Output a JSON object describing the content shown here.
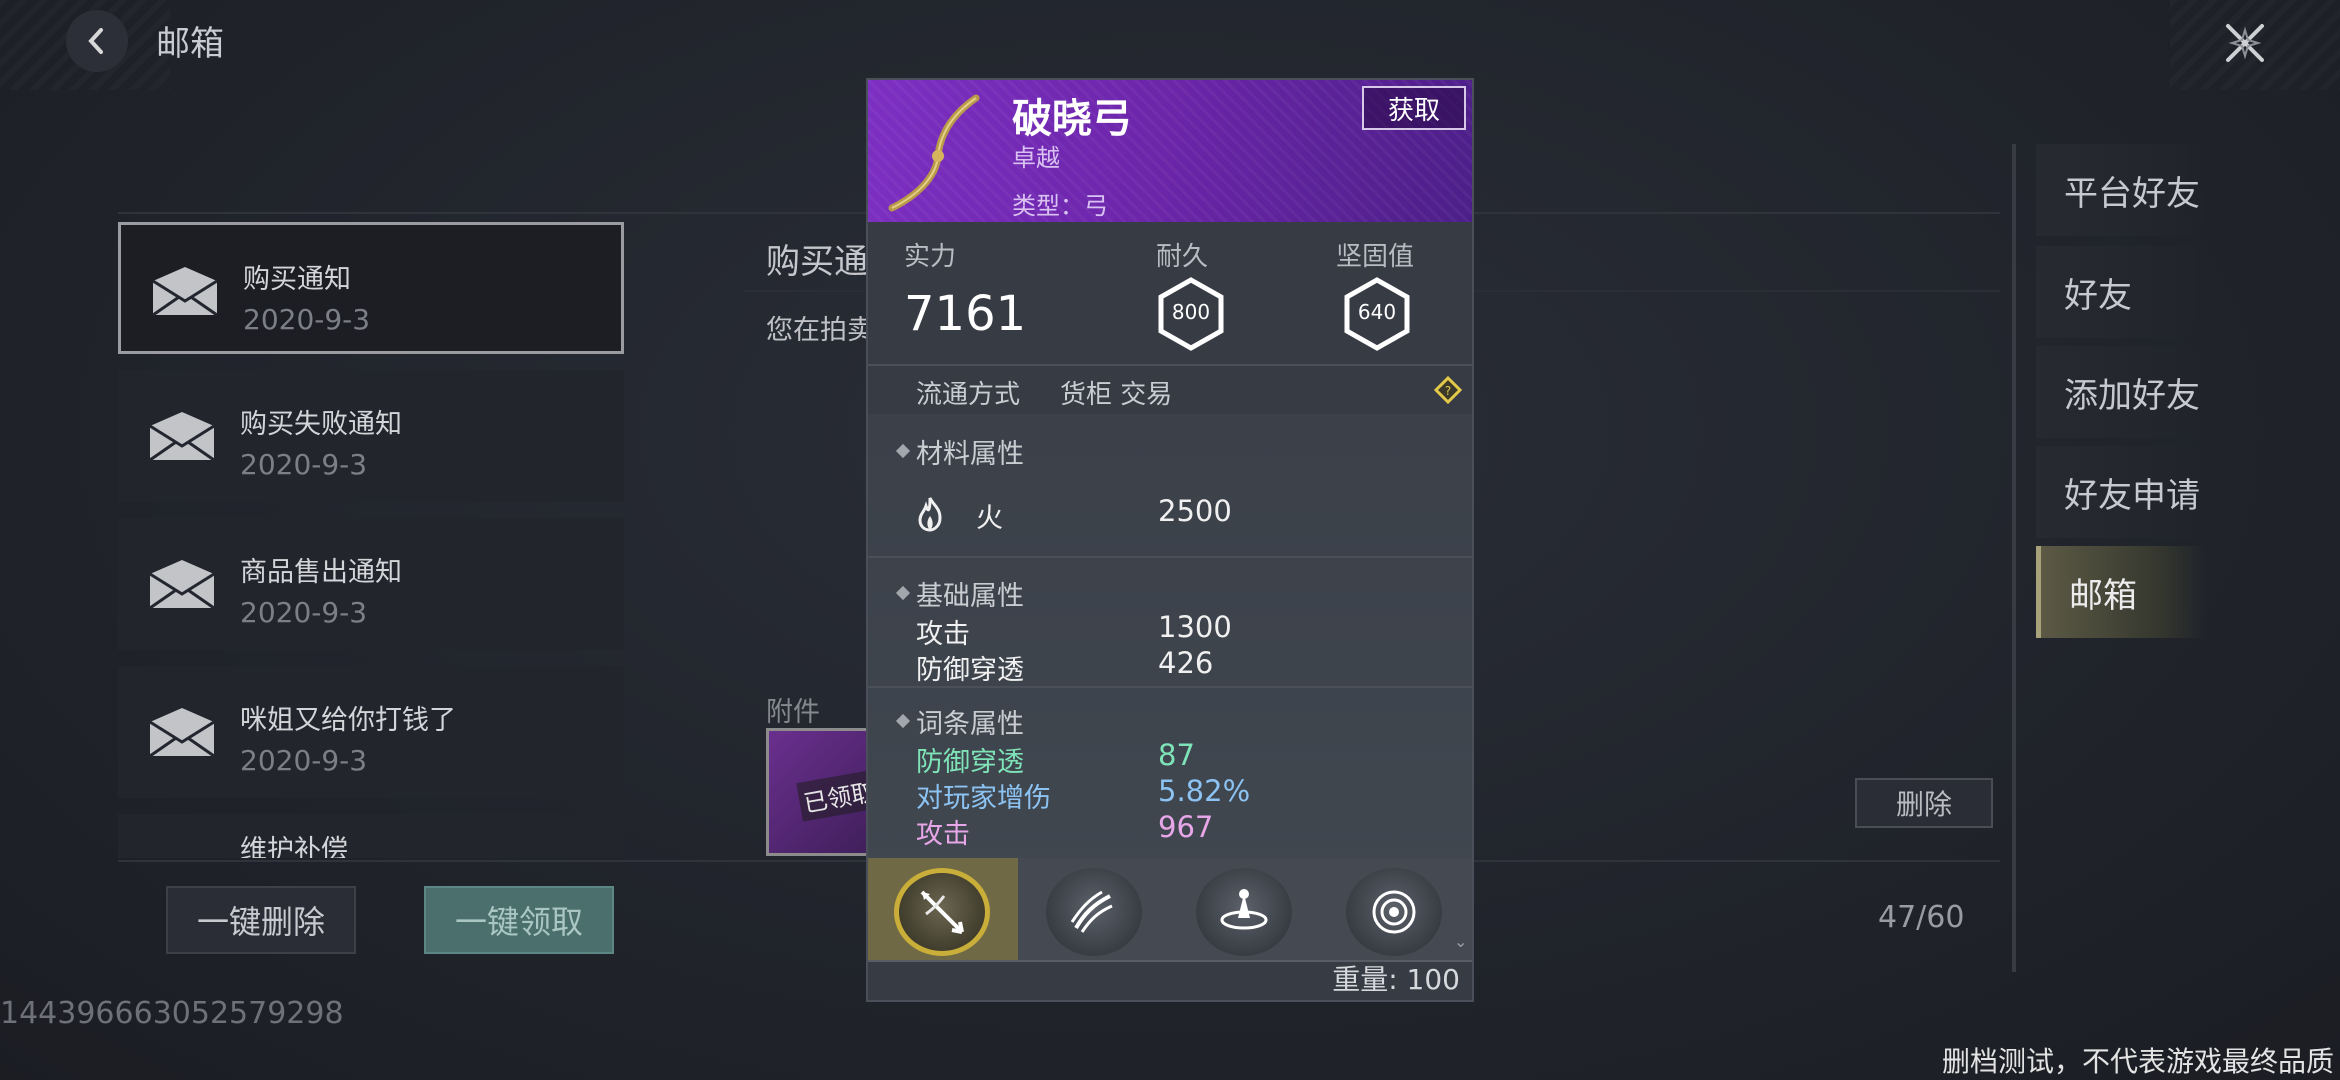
{
  "header": {
    "title": "邮箱"
  },
  "mail_list": [
    {
      "title": "购买通知",
      "date": "2020-9-3",
      "selected": true
    },
    {
      "title": "购买失败通知",
      "date": "2020-9-3"
    },
    {
      "title": "商品售出通知",
      "date": "2020-9-3"
    },
    {
      "title": "咪姐又给你打钱了",
      "date": "2020-9-3"
    },
    {
      "title": "维护补偿",
      "date": ""
    }
  ],
  "mail_detail": {
    "subject": "购买通",
    "body": "您在拍卖",
    "attachment_label": "附件",
    "attachment_status": "已领取",
    "delete_label": "删除"
  },
  "footer": {
    "delete_all": "一键删除",
    "claim_all": "一键领取",
    "count": "47/60",
    "uid": "1443966630525792​98",
    "disclaimer": "删档测试，不代表游戏最终品质"
  },
  "nav": [
    {
      "label": "平台好友"
    },
    {
      "label": "好友"
    },
    {
      "label": "添加好友"
    },
    {
      "label": "好友申请"
    },
    {
      "label": "邮箱",
      "active": true
    }
  ],
  "item_card": {
    "name": "破晓弓",
    "rarity": "卓越",
    "type": "类型：弓",
    "obtain": "获取",
    "power_label": "实力",
    "power_value": "7161",
    "durability_label": "耐久",
    "durability_value": "800",
    "toughness_label": "坚固值",
    "toughness_value": "640",
    "circulation_label": "流通方式",
    "circulation_value": "货柜 交易",
    "material_title": "材料属性",
    "material": {
      "name": "火",
      "value": "2500"
    },
    "base_title": "基础属性",
    "base": [
      {
        "name": "攻击",
        "value": "1300"
      },
      {
        "name": "防御穿透",
        "value": "426"
      }
    ],
    "affix_title": "词条属性",
    "affix": [
      {
        "name": "防御穿透",
        "value": "87",
        "color": "#7fe3b8"
      },
      {
        "name": "对玩家增伤",
        "value": "5.82%",
        "color": "#8cc3f2"
      },
      {
        "name": "攻击",
        "value": "967",
        "color": "#e6a6e8"
      }
    ],
    "weight": "重量: 100",
    "skills": [
      "bow-arrow-icon",
      "swift-shot-icon",
      "spin-icon",
      "vortex-icon"
    ]
  },
  "colors": {
    "rarity_purple": "#7d2fc2",
    "accent_gold": "#c9ae3a"
  }
}
